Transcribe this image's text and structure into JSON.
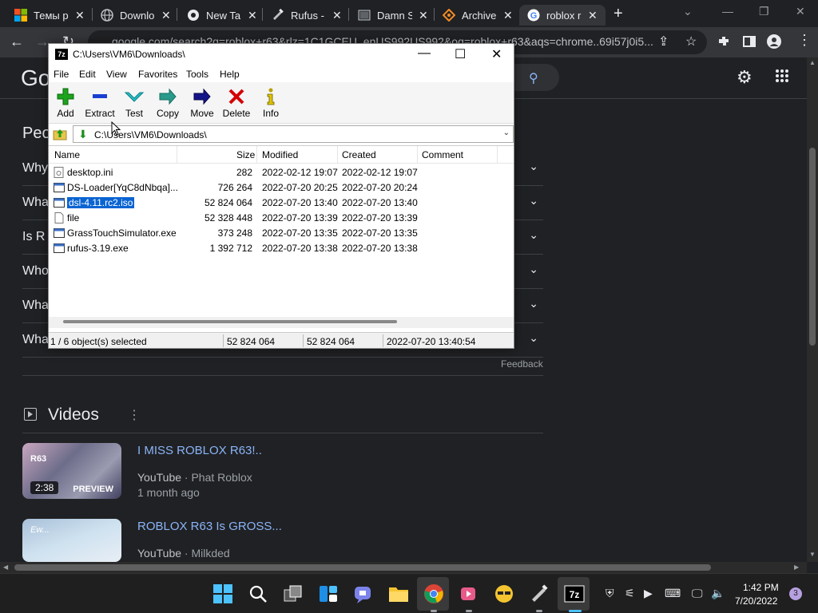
{
  "browser": {
    "tabs": [
      {
        "title": "Темы р",
        "icon": "microsoft-icon"
      },
      {
        "title": "Downlo",
        "icon": "globe-icon"
      },
      {
        "title": "New Tal",
        "icon": "chrome-icon"
      },
      {
        "title": "Rufus -",
        "icon": "rufus-icon"
      },
      {
        "title": "Damn S",
        "icon": "damn-icon"
      },
      {
        "title": "Archive",
        "icon": "archive-icon"
      },
      {
        "title": "roblox r",
        "icon": "google-icon",
        "active": true
      }
    ],
    "url": "google.com/search?q=roblox+r63&rlz=1C1GCEU_enUS992US992&oq=roblox+r63&aqs=chrome..69i57j0i5..."
  },
  "google": {
    "logo": "Go",
    "paa_title": "Peo",
    "paa_questions": [
      "Why",
      "Wha",
      "Is R",
      "Who",
      "Wha",
      "Wha"
    ],
    "feedback": "Feedback",
    "videos_title": "Videos",
    "videos": [
      {
        "title": "I MISS ROBLOX R63!..",
        "source": "YouTube",
        "channel": "Phat Roblox",
        "age": "1 month ago",
        "duration": "2:38",
        "preview": "PREVIEW",
        "overlay": "R63"
      },
      {
        "title": "ROBLOX R63 Is GROSS...",
        "source": "YouTube",
        "channel": "Milkded",
        "overlay": "Ew..."
      }
    ]
  },
  "zip": {
    "title": "C:\\Users\\VM6\\Downloads\\",
    "menu": [
      "File",
      "Edit",
      "View",
      "Favorites",
      "Tools",
      "Help"
    ],
    "toolbar": [
      "Add",
      "Extract",
      "Test",
      "Copy",
      "Move",
      "Delete",
      "Info"
    ],
    "path": "C:\\Users\\VM6\\Downloads\\",
    "columns": [
      "Name",
      "Size",
      "Modified",
      "Created",
      "Comment"
    ],
    "files": [
      {
        "name": "desktop.ini",
        "size": "282",
        "modified": "2022-02-12 19:07",
        "created": "2022-02-12 19:07",
        "type": "ini"
      },
      {
        "name": "DS-Loader[YqC8dNbqa]...",
        "size": "726 264",
        "modified": "2022-07-20 20:25",
        "created": "2022-07-20 20:24",
        "type": "exe"
      },
      {
        "name": "dsl-4.11.rc2.iso",
        "size": "52 824 064",
        "modified": "2022-07-20 13:40",
        "created": "2022-07-20 13:40",
        "type": "iso",
        "selected": true
      },
      {
        "name": "file",
        "size": "52 328 448",
        "modified": "2022-07-20 13:39",
        "created": "2022-07-20 13:39",
        "type": "file"
      },
      {
        "name": "GrassTouchSimulator.exe",
        "size": "373 248",
        "modified": "2022-07-20 13:35",
        "created": "2022-07-20 13:35",
        "type": "exe"
      },
      {
        "name": "rufus-3.19.exe",
        "size": "1 392 712",
        "modified": "2022-07-20 13:38",
        "created": "2022-07-20 13:38",
        "type": "exe"
      }
    ],
    "status": {
      "selection": "1 / 6 object(s) selected",
      "size": "52 824 064",
      "packed": "52 824 064",
      "date": "2022-07-20 13:40:54"
    }
  },
  "taskbar": {
    "time": "1:42 PM",
    "date": "7/20/2022",
    "notifications": "3"
  }
}
